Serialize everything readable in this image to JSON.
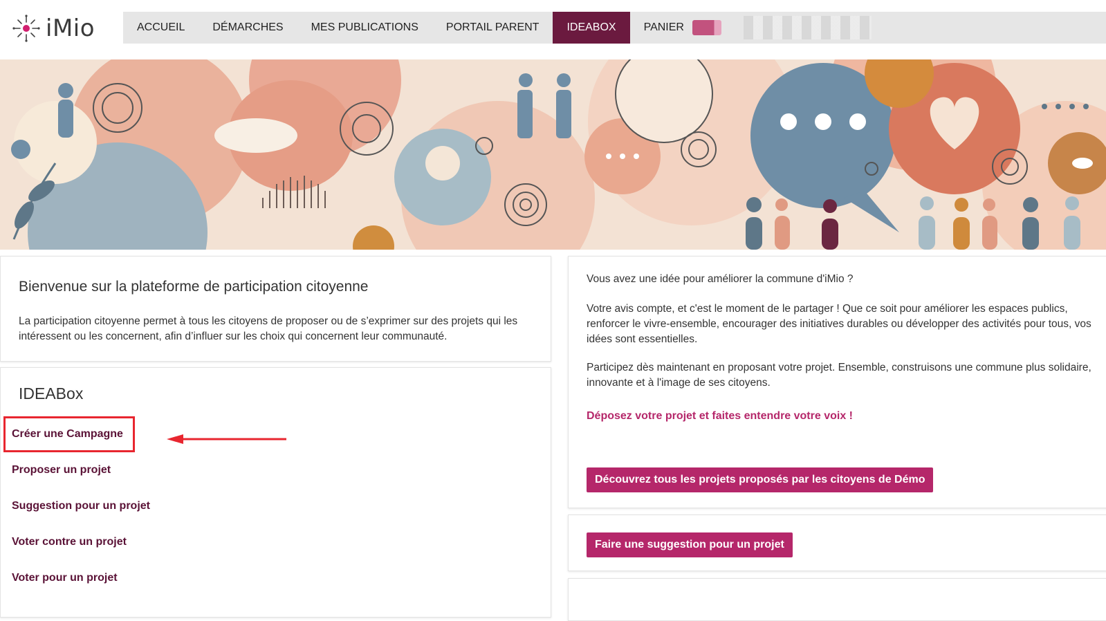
{
  "brand": {
    "logo_text": "iMio"
  },
  "nav": {
    "items": [
      {
        "label": "ACCUEIL"
      },
      {
        "label": "DÉMARCHES"
      },
      {
        "label": "MES PUBLICATIONS"
      },
      {
        "label": "PORTAIL PARENT"
      },
      {
        "label": "IDEABOX"
      },
      {
        "label": "PANIER"
      }
    ],
    "active": "IDEABOX"
  },
  "welcome": {
    "title": "Bienvenue sur la plateforme de participation citoyenne",
    "text": "La participation citoyenne permet à tous les citoyens de proposer ou de s’exprimer sur des projets qui les intéressent ou les concernent, afin d’influer sur les choix qui concernent leur communauté."
  },
  "ideabox": {
    "title": "IDEABox",
    "links": [
      {
        "label": "Créer une Campagne"
      },
      {
        "label": "Proposer un projet"
      },
      {
        "label": "Suggestion pour un projet"
      },
      {
        "label": "Voter contre un projet"
      },
      {
        "label": "Voter pour un projet"
      }
    ]
  },
  "right": {
    "p1": "Vous avez une idée pour améliorer la commune d'iMio ?",
    "p2": "Votre avis compte, et c'est le moment de le partager ! Que ce soit pour améliorer les espaces publics, renforcer le vivre-ensemble, encourager des initiatives durables ou développer des activités pour tous, vos idées sont essentielles.",
    "p3": "Participez dès maintenant en proposant votre projet. Ensemble, construisons une commune plus solidaire, innovante et à l'image de ses citoyens.",
    "cta": "Déposez votre projet et faites entendre votre voix !",
    "button_discover": "Découvrez tous les projets proposés par les citoyens de Démo",
    "button_suggest": "Faire une suggestion pour un projet"
  },
  "colors": {
    "accent": "#b5276a",
    "nav_active": "#6b1a3f",
    "link": "#5a1236",
    "highlight": "#e8262f"
  }
}
